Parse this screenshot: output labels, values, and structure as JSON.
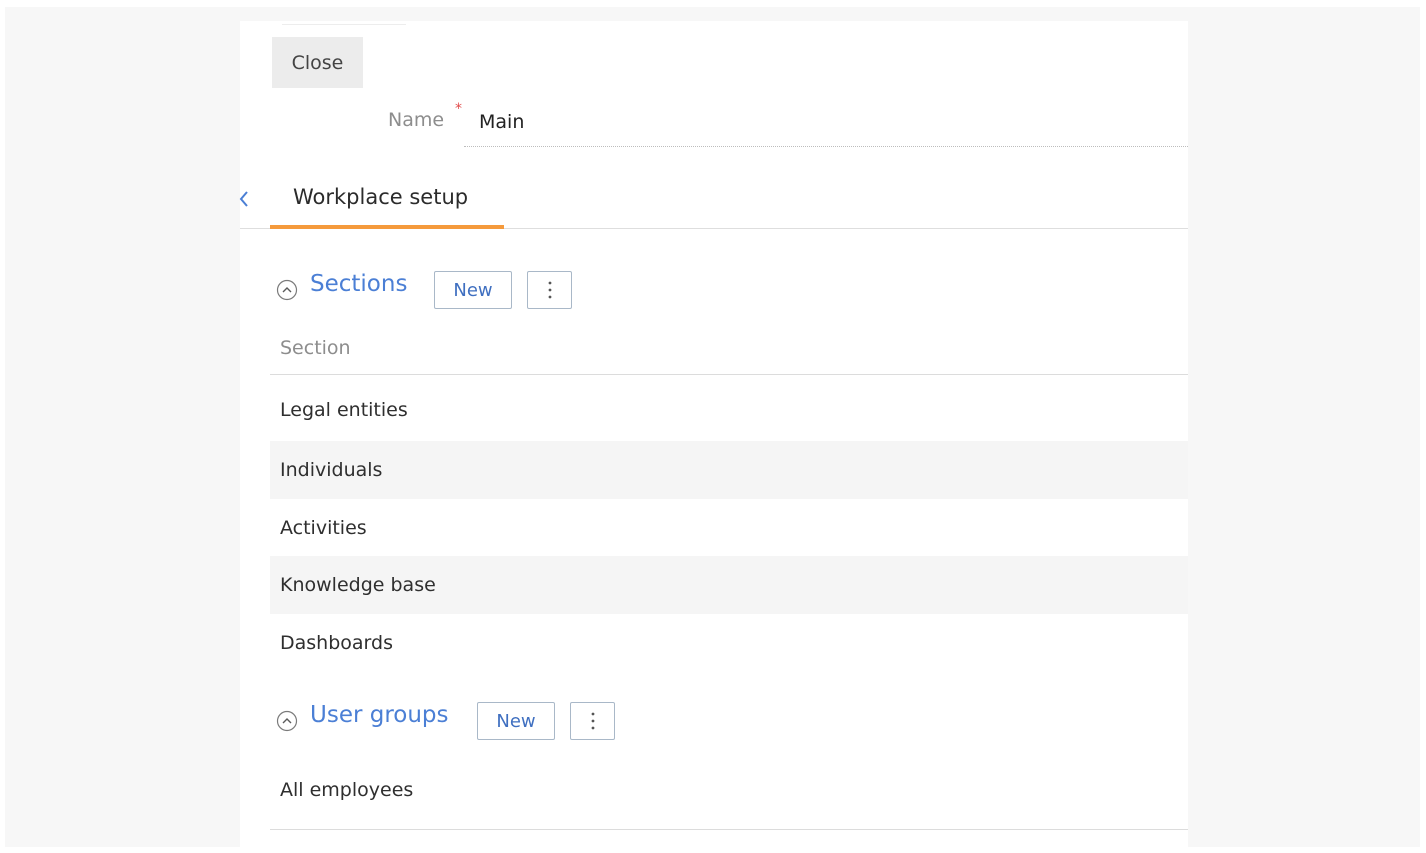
{
  "toolbar": {
    "close_label": "Close"
  },
  "form": {
    "name_label": "Name",
    "required_marker": "*",
    "name_value": "Main"
  },
  "tabs": [
    {
      "label": "Workplace setup",
      "active": true
    }
  ],
  "sections_block": {
    "title": "Sections",
    "new_label": "New",
    "column_header": "Section",
    "rows": [
      "Legal entities",
      "Individuals",
      "Activities",
      "Knowledge base",
      "Dashboards"
    ]
  },
  "user_groups_block": {
    "title": "User groups",
    "new_label": "New",
    "rows": [
      "All employees"
    ]
  },
  "icons": {
    "back": "chevron-left-icon",
    "collapse": "circle-chevron-up-icon",
    "more": "vertical-dots-icon"
  },
  "colors": {
    "accent_blue": "#4b7fd5",
    "tab_underline": "#f59a3c",
    "required": "#e14b4b"
  }
}
